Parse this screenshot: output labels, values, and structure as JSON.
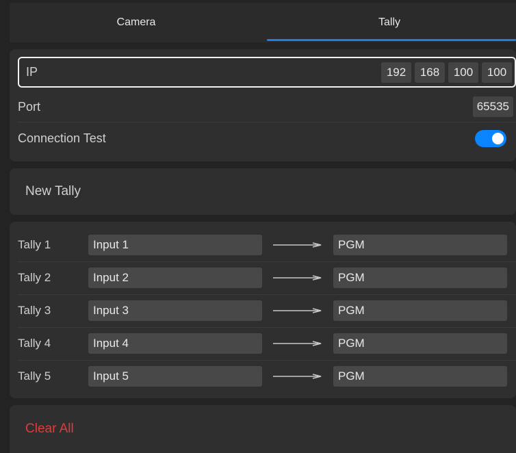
{
  "tabs": [
    {
      "label": "Camera",
      "active": false
    },
    {
      "label": "Tally",
      "active": true
    }
  ],
  "network": {
    "ip_label": "IP",
    "ip_octets": [
      "192",
      "168",
      "100",
      "100"
    ],
    "port_label": "Port",
    "port_value": "65535",
    "connection_test_label": "Connection Test",
    "connection_test_on": true
  },
  "new_tally_label": "New Tally",
  "tallies": [
    {
      "name": "Tally 1",
      "input": "Input 1",
      "output": "PGM"
    },
    {
      "name": "Tally 2",
      "input": "Input 2",
      "output": "PGM"
    },
    {
      "name": "Tally 3",
      "input": "Input 3",
      "output": "PGM"
    },
    {
      "name": "Tally 4",
      "input": "Input 4",
      "output": "PGM"
    },
    {
      "name": "Tally 5",
      "input": "Input 5",
      "output": "PGM"
    }
  ],
  "clear_all_label": "Clear All",
  "colors": {
    "accent": "#1f7fe6",
    "toggle_on": "#0a84ff",
    "danger": "#e23b3b",
    "background": "#232323",
    "card": "#2f2f2f"
  }
}
